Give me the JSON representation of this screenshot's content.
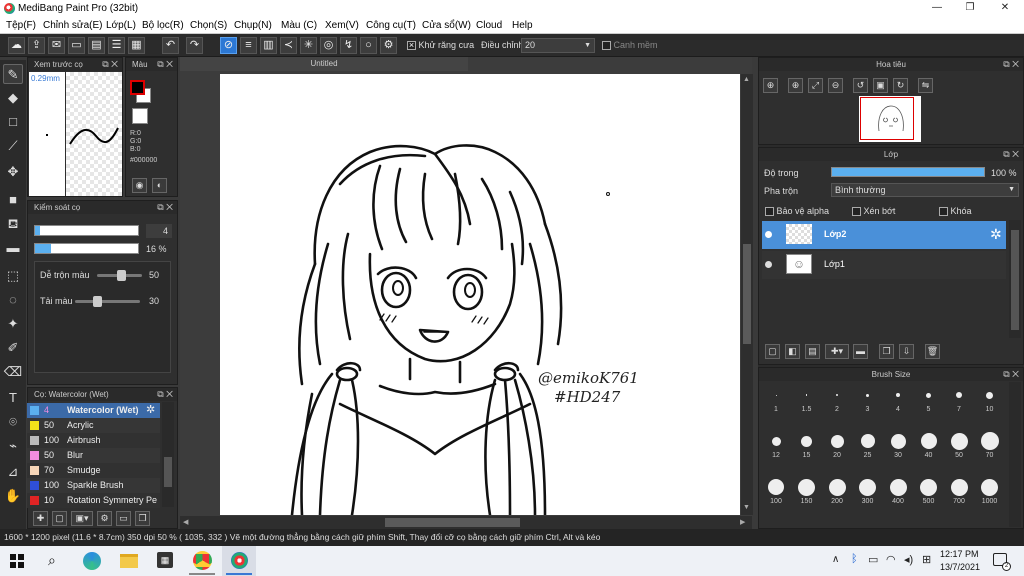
{
  "window": {
    "title": "MediBang Paint Pro (32bit)"
  },
  "menu": [
    "Tệp(F)",
    "Chỉnh sửa(E)",
    "Lớp(L)",
    "Bộ lọc(R)",
    "Chọn(S)",
    "Chụp(N)",
    "Màu (C)",
    "Xem(V)",
    "Công cụ(T)",
    "Cửa sổ(W)",
    "Cloud",
    "Help"
  ],
  "toolbar": {
    "antialias_label": "Khử răng cưa",
    "correction_label": "Điều chỉnh",
    "correction_value": "20",
    "snap_label": "Canh mềm"
  },
  "preview": {
    "title": "Xem trước cọ",
    "size": "0.29mm"
  },
  "color": {
    "title": "Màu",
    "r": "R:0",
    "g": "G:0",
    "b": "B:0",
    "hex": "#000000",
    "primary": "#000000",
    "secondary": "#ffffff"
  },
  "brushctrl": {
    "title": "Kiểm soát cọ",
    "size_value": "4",
    "opacity_value": "16 %",
    "blend_label": "Dễ trộn màu",
    "blend_value": "50",
    "paint_label": "Tải màu",
    "paint_value": "30"
  },
  "brushes": {
    "title": "Cọ: Watercolor (Wet)",
    "items": [
      {
        "num": "4",
        "name": "Watercolor (Wet)",
        "color": "#5bb0f0"
      },
      {
        "num": "50",
        "name": "Acrylic",
        "color": "#f2e21a"
      },
      {
        "num": "100",
        "name": "Airbrush",
        "color": "#bbbbbb"
      },
      {
        "num": "50",
        "name": "Blur",
        "color": "#f28ce0"
      },
      {
        "num": "70",
        "name": "Smudge",
        "color": "#f7d6b8"
      },
      {
        "num": "100",
        "name": "Sparkle Brush",
        "color": "#2f4fd8"
      },
      {
        "num": "10",
        "name": "Rotation Symmetry Pe",
        "color": "#e02424"
      }
    ]
  },
  "canvas": {
    "tab": "Untitled",
    "signature": "@emikoK761",
    "tag": "#HD247"
  },
  "navigator": {
    "title": "Hoa tiêu"
  },
  "layers": {
    "title": "Lớp",
    "opacity_label": "Độ trong",
    "opacity_value": "100 %",
    "opacity": 1.0,
    "blend_label": "Pha trộn",
    "blend_value": "Bình thường",
    "alpha_label": "Bảo vệ alpha",
    "clip_label": "Xén bớt",
    "lock_label": "Khóa",
    "items": [
      {
        "name": "Lớp2"
      },
      {
        "name": "Lớp1"
      }
    ]
  },
  "brushsize": {
    "title": "Brush Size",
    "sizes": [
      "1",
      "1.5",
      "2",
      "3",
      "4",
      "5",
      "7",
      "10",
      "12",
      "15",
      "20",
      "25",
      "30",
      "40",
      "50",
      "70",
      "100",
      "150",
      "200",
      "300",
      "400",
      "500",
      "700",
      "1000"
    ]
  },
  "status": {
    "text": "1600 * 1200 pixel   (11.6 * 8.7cm)   350 dpi   50 %   ( 1035, 332 )   Vẽ một đường thẳng bằng cách giữ phím Shift, Thay đổi cỡ cọ bằng cách giữ phím Ctrl, Alt và kéo"
  },
  "taskbar": {
    "time": "12:17 PM",
    "date": "13/7/2021"
  }
}
